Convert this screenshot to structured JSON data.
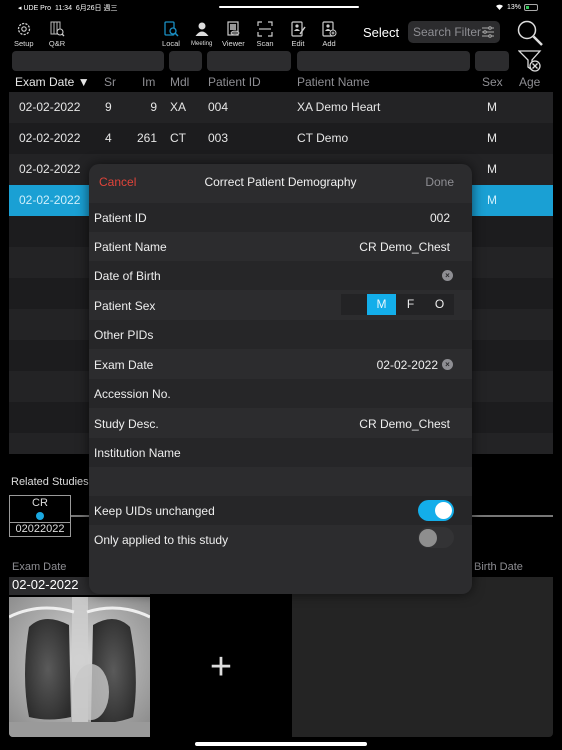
{
  "status_bar": {
    "back_app": "◂ UDE Pro",
    "time": "11:34",
    "date": "6月26日 週三",
    "battery": "13%"
  },
  "toolbar": {
    "left": [
      {
        "label": "Setup",
        "icon": "gear-icon"
      },
      {
        "label": "Q&R",
        "icon": "query-retrieve-icon"
      }
    ],
    "center": [
      {
        "label": "Local",
        "icon": "local-search-icon"
      },
      {
        "label": "Meeting",
        "icon": "person-icon"
      },
      {
        "label": "Viewer",
        "icon": "viewer-icon"
      },
      {
        "label": "Scan",
        "icon": "scan-icon"
      },
      {
        "label": "Edit",
        "icon": "edit-icon"
      },
      {
        "label": "Add",
        "icon": "add-icon"
      }
    ],
    "select_label": "Select",
    "search_filter_placeholder": "Search Filter",
    "accent": "#1a8fc4"
  },
  "table": {
    "columns": [
      "Exam Date ▼",
      "Sr",
      "Im",
      "Mdl",
      "Patient ID",
      "Patient Name",
      "Sex",
      "Age"
    ],
    "rows": [
      {
        "date": "02-02-2022",
        "sr": "9",
        "im": "9",
        "mdl": "XA",
        "pid": "004",
        "name": "XA Demo Heart",
        "sex": "M"
      },
      {
        "date": "02-02-2022",
        "sr": "4",
        "im": "261",
        "mdl": "CT",
        "pid": "003",
        "name": "CT Demo",
        "sex": "M"
      },
      {
        "date": "02-02-2022",
        "sr": "",
        "im": "",
        "mdl": "",
        "pid": "",
        "name": "",
        "sex": "M"
      },
      {
        "date": "02-02-2022",
        "sr": "",
        "im": "",
        "mdl": "",
        "pid": "",
        "name": "",
        "sex": "M",
        "selected": true
      }
    ],
    "selected_color": "#1aa0d4"
  },
  "related": {
    "label": "Related Studies",
    "study_modality": "CR",
    "study_date": "02022022"
  },
  "bottom": {
    "exam_date_header": "Exam Date",
    "birth_date_header": "Birth Date",
    "exam_date_value": "02-02-2022",
    "add_symbol": "+"
  },
  "modal": {
    "title": "Correct Patient Demography",
    "cancel": "Cancel",
    "done": "Done",
    "fields": [
      {
        "label": "Patient ID",
        "value": "002"
      },
      {
        "label": "Patient Name",
        "value": "CR Demo_Chest"
      },
      {
        "label": "Date of Birth",
        "value": ""
      },
      {
        "label": "Patient Sex",
        "value": "M"
      },
      {
        "label": "Other PIDs",
        "value": ""
      },
      {
        "label": "Exam Date",
        "value": "02-02-2022"
      },
      {
        "label": "Accession No.",
        "value": ""
      },
      {
        "label": "Study Desc.",
        "value": "CR Demo_Chest"
      },
      {
        "label": "Institution Name",
        "value": ""
      }
    ],
    "sex_options": [
      "M",
      "F",
      "O"
    ],
    "sex_selected": "M",
    "toggles": [
      {
        "label": "Keep UIDs unchanged",
        "on": true
      },
      {
        "label": "Only applied to this study",
        "on": false
      }
    ],
    "cancel_color": "#e0443a",
    "toggle_on_color": "#13aeea"
  }
}
